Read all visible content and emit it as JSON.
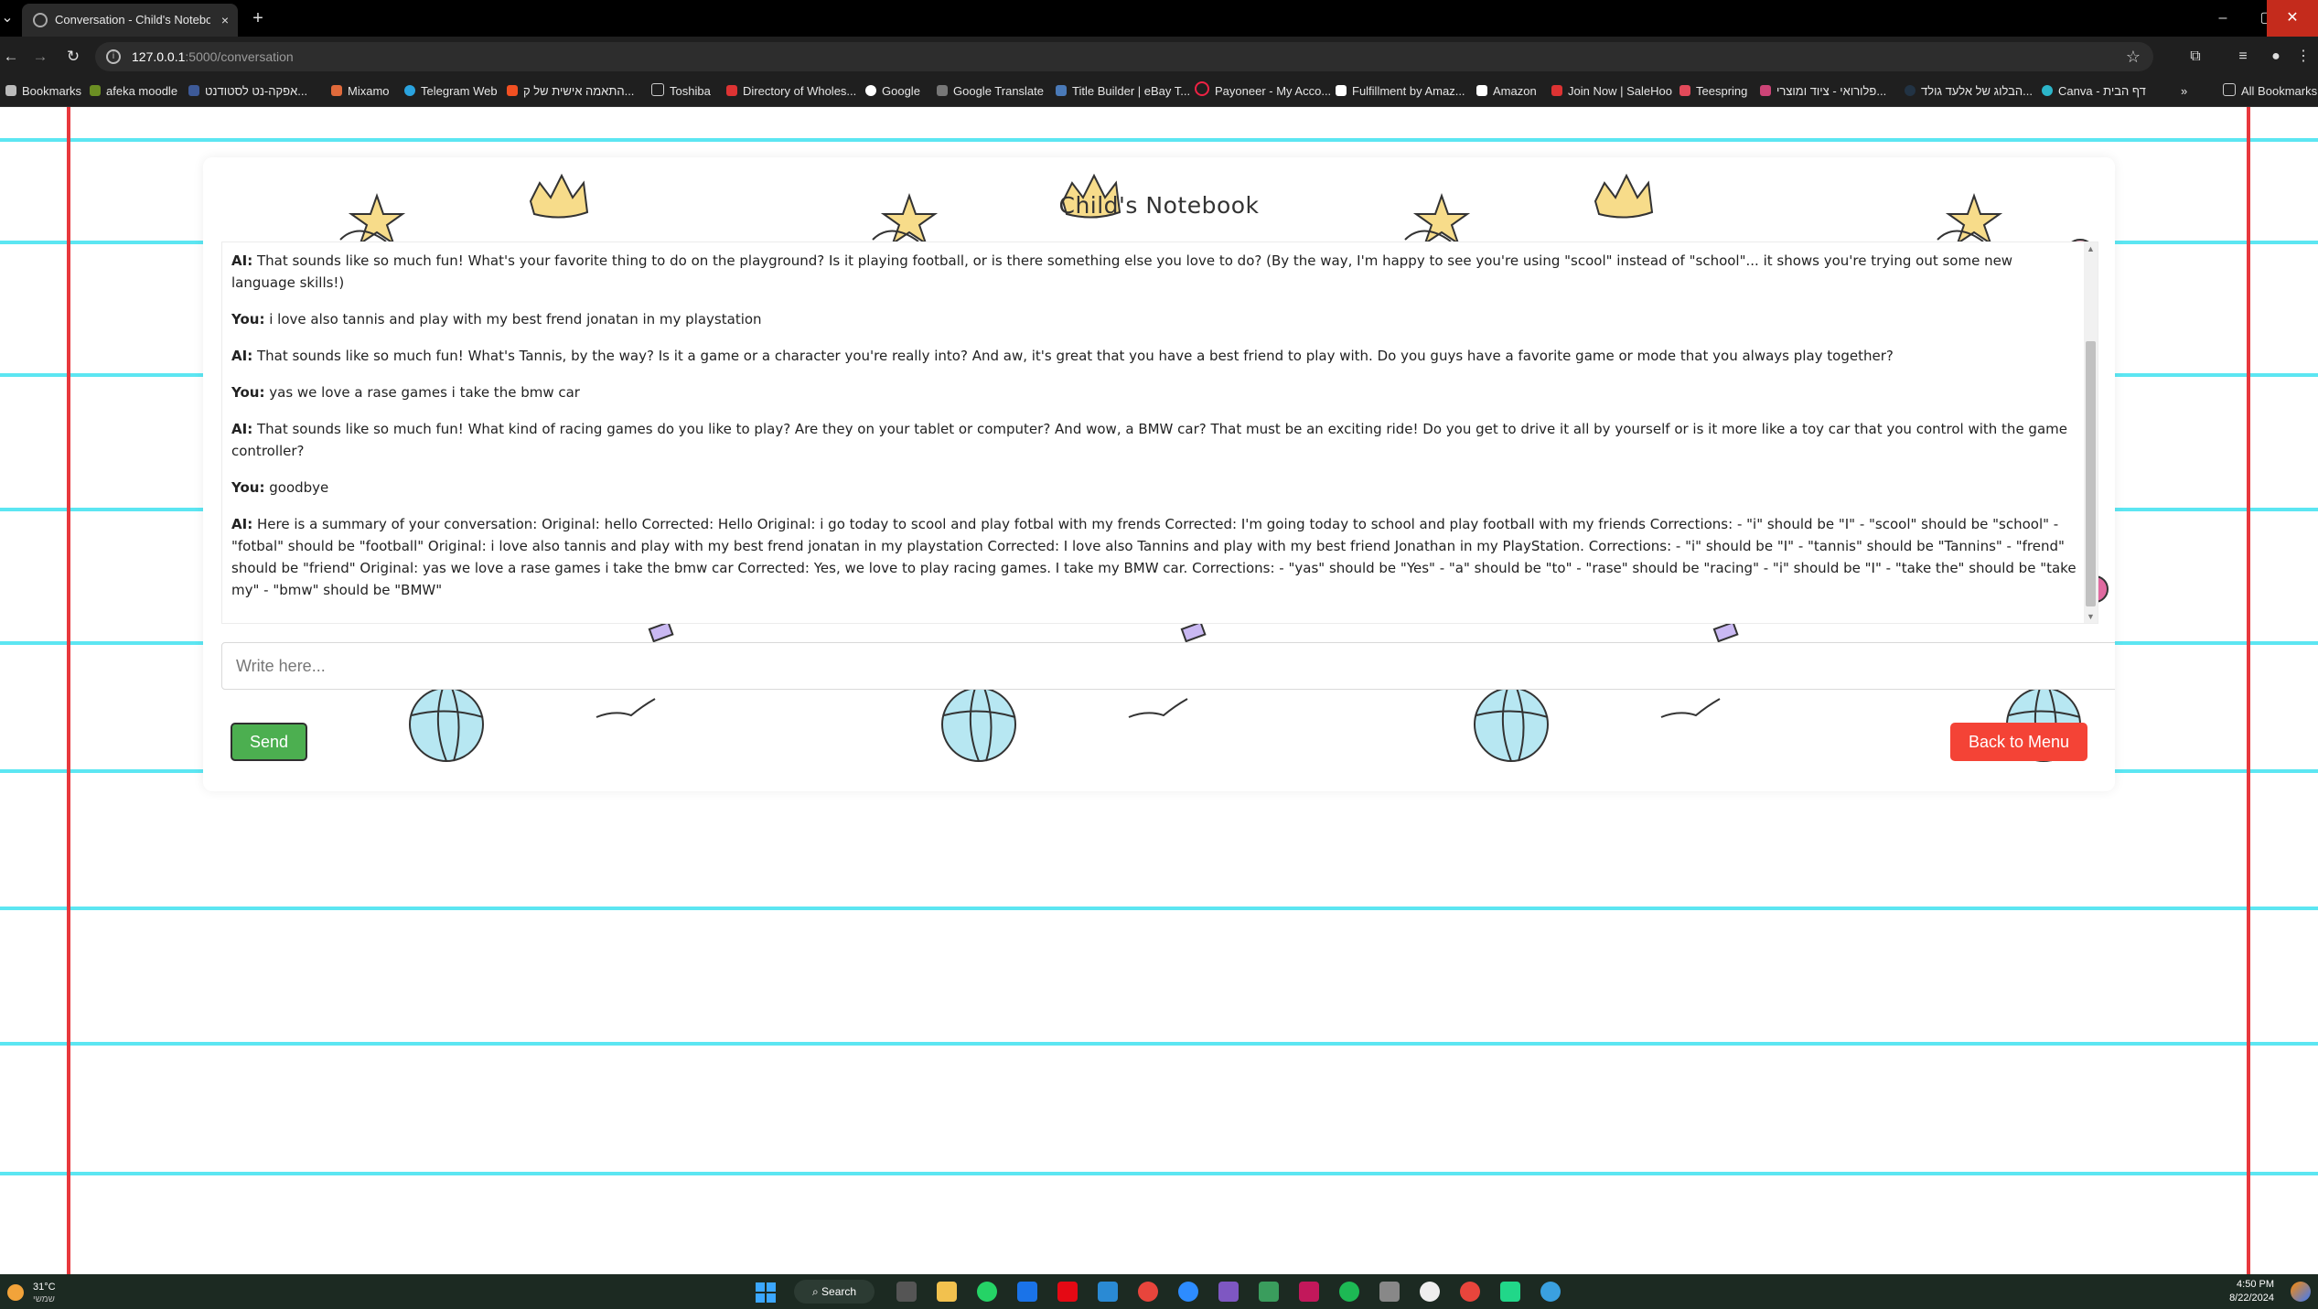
{
  "browser": {
    "tab_title": "Conversation - Child's Notebook",
    "tab_close": "×",
    "new_tab": "+",
    "url_host": "127.0.0.1",
    "url_rest": ":5000/conversation",
    "window_controls": [
      "–",
      "▢",
      "✕"
    ],
    "bookmarks": [
      "Bookmarks",
      "afeka moodle",
      "אפקה-נט לסטודנט...",
      "Mixamo",
      "Telegram Web",
      "התאמה אישית של ק...",
      "Toshiba",
      "Directory of Wholes...",
      "Google",
      "Google Translate",
      "Title Builder | eBay T...",
      "Payoneer - My Acco...",
      "Fulfillment by Amaz...",
      "Amazon",
      "Join Now | SaleHoo",
      "Teespring",
      "פלורואי - ציוד ומוצרי...",
      "הבלוג של אלעד גולד...",
      "Canva - דף הבית",
      "»",
      "All Bookmarks"
    ]
  },
  "app": {
    "title": "Child's Notebook",
    "messages": [
      {
        "speaker": "AI:",
        "text": "That sounds like so much fun! What's your favorite thing to do on the playground? Is it playing football, or is there something else you love to do? (By the way, I'm happy to see you're using \"scool\" instead of \"school\"... it shows you're trying out some new language skills!)"
      },
      {
        "speaker": "You:",
        "text": "i love also tannis and play with my best frend jonatan in my playstation"
      },
      {
        "speaker": "AI:",
        "text": "That sounds like so much fun! What's Tannis, by the way? Is it a game or a character you're really into? And aw, it's great that you have a best friend to play with. Do you guys have a favorite game or mode that you always play together?"
      },
      {
        "speaker": "You:",
        "text": "yas we love a rase games i take the bmw car"
      },
      {
        "speaker": "AI:",
        "text": "That sounds like so much fun! What kind of racing games do you like to play? Are they on your tablet or computer? And wow, a BMW car? That must be an exciting ride! Do you get to drive it all by yourself or is it more like a toy car that you control with the game controller?"
      },
      {
        "speaker": "You:",
        "text": "goodbye"
      },
      {
        "speaker": "AI:",
        "text": "Here is a summary of your conversation: Original: hello Corrected: Hello Original: i go today to scool and play fotbal with my frends Corrected: I'm going today to school and play football with my friends Corrections: - \"i\" should be \"I\" - \"scool\" should be \"school\" - \"fotbal\" should be \"football\" Original: i love also tannis and play with my best frend jonatan in my playstation Corrected: I love also Tannins and play with my best friend Jonathan in my PlayStation. Corrections: - \"i\" should be \"I\" - \"tannis\" should be \"Tannins\" - \"frend\" should be \"friend\" Original: yas we love a rase games i take the bmw car Corrected: Yes, we love to play racing games. I take my BMW car. Corrections: - \"yas\" should be \"Yes\" - \"a\" should be \"to\" - \"rase\" should be \"racing\" - \"i\" should be \"I\" - \"take the\" should be \"take my\" - \"bmw\" should be \"BMW\""
      }
    ],
    "input_placeholder": "Write here...",
    "send_label": "Send",
    "back_label": "Back to Menu"
  },
  "taskbar": {
    "temperature": "31°C",
    "weather_desc": "שמשי",
    "search_label": "Search",
    "time": "4:50 PM",
    "date": "8/22/2024"
  },
  "colors": {
    "send_button": "#4caf50",
    "back_button": "#f44336",
    "ruled_line": "#5ce6f2",
    "margin_line": "#e8383d"
  }
}
